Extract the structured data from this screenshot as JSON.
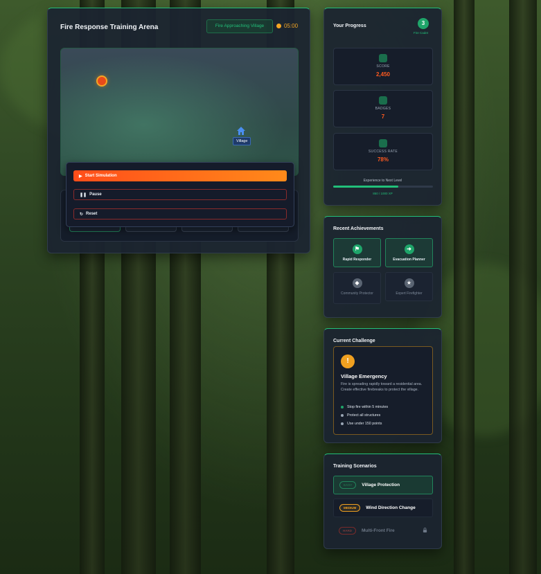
{
  "arena": {
    "title": "Fire Response Training Arena",
    "status": "Fire Approaching Village",
    "timer": "05:00",
    "village_label": "Village",
    "controls": {
      "start": "Start Simulation",
      "pause": "Pause",
      "reset": "Reset"
    }
  },
  "progress": {
    "title": "Your Progress",
    "level": "3",
    "rank": "Fire Cadet",
    "stats": [
      {
        "label": "SCORE",
        "value": "2,450"
      },
      {
        "label": "BADGES",
        "value": "7"
      },
      {
        "label": "SUCCESS RATE",
        "value": "78%"
      }
    ],
    "xp_label": "Experience to Next Level",
    "xp_text": "850 / 1000 XP",
    "xp_fraction": 0.65
  },
  "achievements": {
    "title": "Recent Achievements",
    "items": [
      {
        "label": "Rapid Responder",
        "unlocked": true
      },
      {
        "label": "Evacuation Planner",
        "unlocked": true
      },
      {
        "label": "Community Protector",
        "unlocked": false
      },
      {
        "label": "Expert Firefighter",
        "unlocked": false
      }
    ]
  },
  "challenge": {
    "title": "Current Challenge",
    "name": "Village Emergency",
    "description": "Fire is spreading rapidly toward a residential area. Create effective firebreaks to protect the village.",
    "objectives": [
      {
        "text": "Stop fire within 5 minutes",
        "color": "#1fa56a"
      },
      {
        "text": "Protect all structures",
        "color": "#9aa6b5"
      },
      {
        "text": "Use under 150 points",
        "color": "#9aa6b5"
      }
    ]
  },
  "scenarios": {
    "title": "Training Scenarios",
    "items": [
      {
        "difficulty": "EASY",
        "name": "Village Protection"
      },
      {
        "difficulty": "MEDIUM",
        "name": "Wind Direction Change"
      },
      {
        "difficulty": "HARD",
        "name": "Multi-Front Fire"
      }
    ]
  },
  "colors": {
    "accent": "#22c07a",
    "fire": "#ff5a1f",
    "warning": "#f0a020"
  }
}
